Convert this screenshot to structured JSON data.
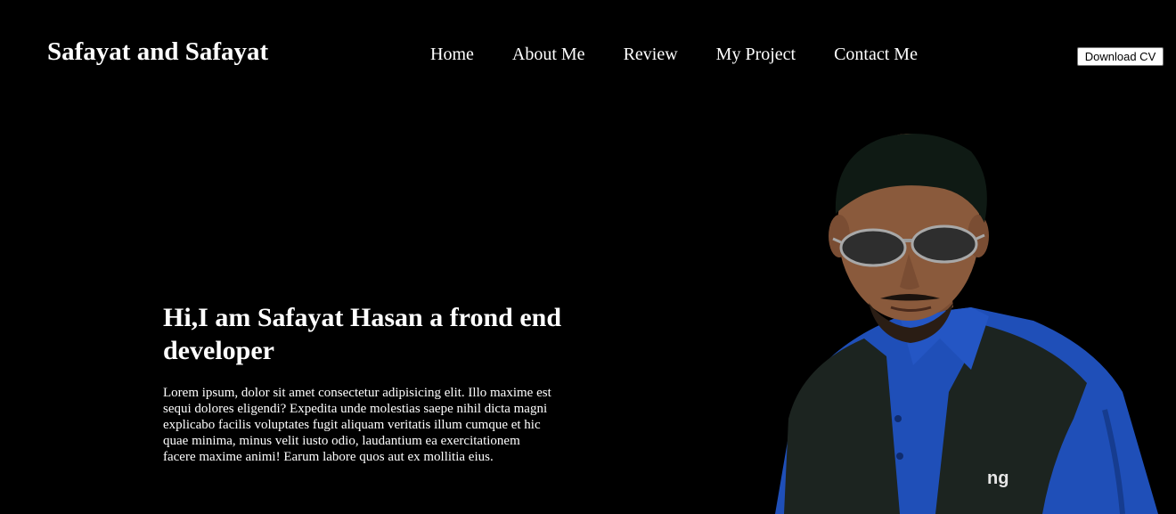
{
  "header": {
    "brand": "Safayat and Safayat",
    "nav": [
      {
        "label": "Home"
      },
      {
        "label": "About Me"
      },
      {
        "label": "Review"
      },
      {
        "label": "My Project"
      },
      {
        "label": "Contact Me"
      }
    ],
    "download_label": "Download CV"
  },
  "hero": {
    "title": "Hi,I am Safayat Hasan a frond end developer",
    "description": "Lorem ipsum, dolor sit amet consectetur adipisicing elit. Illo maxime est sequi dolores eligendi? Expedita unde molestias saepe nihil dicta magni explicabo facilis voluptates fugit aliquam veritatis illum cumque et hic quae minima, minus velit iusto odio, laudantium ea exercitationem facere maxime animi! Earum labore quos aut ex mollitia eius.",
    "image": {
      "icon": "person-photo",
      "vest_logo": "ng"
    }
  },
  "colors": {
    "background": "#000000",
    "text": "#ffffff",
    "shirt": "#1f4fb8",
    "vest": "#1c2420",
    "hair": "#0f1a14",
    "skin": "#8a5a3c"
  }
}
